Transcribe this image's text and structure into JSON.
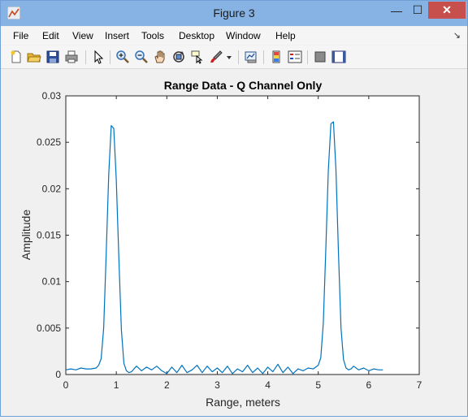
{
  "window": {
    "title": "Figure 3"
  },
  "window_controls": {
    "minimize": "—",
    "maximize": "☐",
    "close": "✕"
  },
  "menu": [
    "File",
    "Edit",
    "View",
    "Insert",
    "Tools",
    "Desktop",
    "Window",
    "Help"
  ],
  "menu_extra": {
    "dock_arrow": "↘"
  },
  "toolbar_icons": [
    "new-figure-icon",
    "open-file-icon",
    "save-icon",
    "print-icon",
    "edit-plot-icon",
    "zoom-in-icon",
    "zoom-out-icon",
    "pan-icon",
    "rotate-3d-icon",
    "data-cursor-icon",
    "brush-icon",
    "link-plot-icon",
    "insert-colorbar-icon",
    "insert-legend-icon",
    "hide-plot-tools-icon",
    "show-plot-tools-icon"
  ],
  "chart_data": {
    "type": "line",
    "title": "Range Data - Q Channel Only",
    "xlabel": "Range, meters",
    "ylabel": "Amplitude",
    "xlim": [
      0,
      7
    ],
    "ylim": [
      0,
      0.03
    ],
    "xticks": [
      "0",
      "1",
      "2",
      "3",
      "4",
      "5",
      "6",
      "7"
    ],
    "yticks": [
      "0",
      "0.005",
      "0.01",
      "0.015",
      "0.02",
      "0.025",
      "0.03"
    ],
    "grid": false,
    "line_color": "#0072bd",
    "series": [
      {
        "x": [
          0,
          0.1,
          0.2,
          0.3,
          0.4,
          0.5,
          0.6,
          0.65,
          0.7,
          0.75,
          0.8,
          0.85,
          0.9,
          0.95,
          1.0,
          1.05,
          1.1,
          1.15,
          1.2,
          1.25,
          1.3,
          1.4,
          1.5,
          1.6,
          1.7,
          1.8,
          1.9,
          2.0,
          2.1,
          2.2,
          2.3,
          2.4,
          2.5,
          2.6,
          2.7,
          2.8,
          2.9,
          3.0,
          3.1,
          3.2,
          3.3,
          3.4,
          3.5,
          3.6,
          3.7,
          3.8,
          3.9,
          4.0,
          4.1,
          4.2,
          4.3,
          4.4,
          4.5,
          4.6,
          4.7,
          4.8,
          4.9,
          5.0,
          5.05,
          5.1,
          5.15,
          5.2,
          5.25,
          5.3,
          5.35,
          5.4,
          5.45,
          5.5,
          5.55,
          5.6,
          5.65,
          5.7,
          5.8,
          5.9,
          6.0,
          6.1,
          6.2,
          6.28
        ],
        "y": [
          0.0005,
          0.0006,
          0.0005,
          0.0007,
          0.0006,
          0.0006,
          0.0007,
          0.001,
          0.0017,
          0.005,
          0.013,
          0.0215,
          0.0268,
          0.0265,
          0.021,
          0.0125,
          0.0048,
          0.0012,
          0.0004,
          0.0002,
          0.0003,
          0.0009,
          0.0004,
          0.0008,
          0.0005,
          0.0009,
          0.0004,
          0.0001,
          0.0008,
          0.0002,
          0.001,
          0.0002,
          0.0005,
          0.001,
          0.0002,
          0.0009,
          0.0003,
          0.0007,
          0.0002,
          0.0009,
          0.0001,
          0.0006,
          0.0003,
          0.001,
          0.0002,
          0.0007,
          0.0001,
          0.0008,
          0.0003,
          0.0011,
          0.0002,
          0.0008,
          0.0001,
          0.0006,
          0.0004,
          0.0007,
          0.0006,
          0.001,
          0.0018,
          0.0055,
          0.0135,
          0.022,
          0.027,
          0.0272,
          0.022,
          0.013,
          0.005,
          0.0016,
          0.0007,
          0.0005,
          0.0006,
          0.0009,
          0.0005,
          0.0007,
          0.0004,
          0.0006,
          0.0005,
          0.0005
        ]
      }
    ]
  }
}
